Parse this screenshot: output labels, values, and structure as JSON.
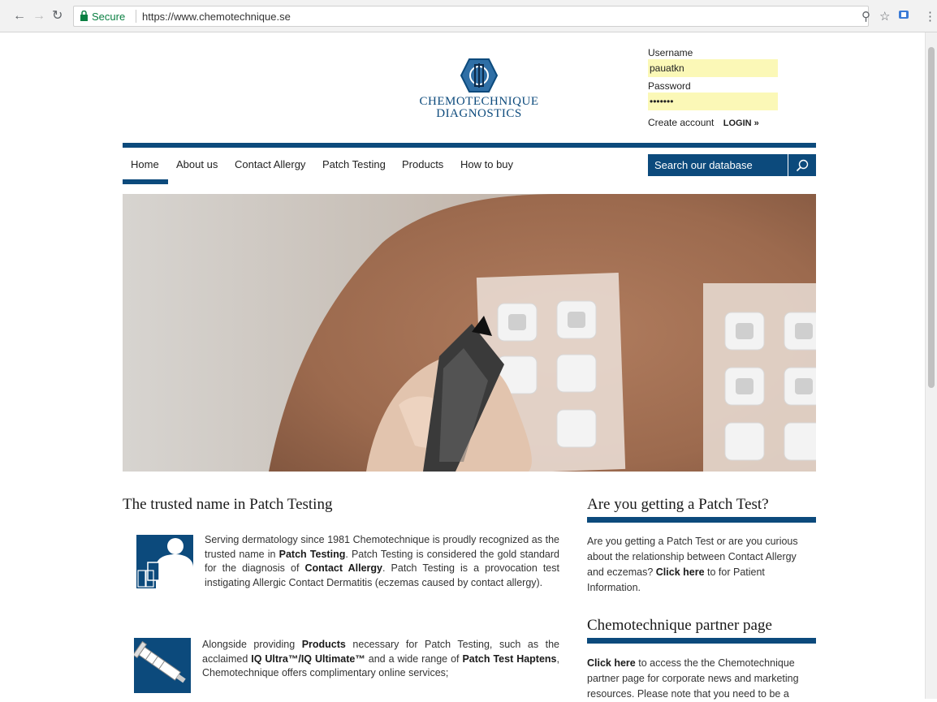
{
  "browser": {
    "secure_label": "Secure",
    "url": "https://www.chemotechnique.se"
  },
  "logo": {
    "line1": "CHEMOTECHNIQUE",
    "line2": "DIAGNOSTICS"
  },
  "login": {
    "username_label": "Username",
    "username_value": "pauatkn",
    "password_label": "Password",
    "password_value": "•••••••",
    "create_account": "Create account",
    "login_button": "LOGIN »"
  },
  "nav": {
    "items": [
      {
        "label": "Home"
      },
      {
        "label": "About us"
      },
      {
        "label": "Contact Allergy"
      },
      {
        "label": "Patch Testing"
      },
      {
        "label": "Products"
      },
      {
        "label": "How to buy"
      }
    ],
    "search_placeholder": "Search our database"
  },
  "main": {
    "title": "The trusted name in Patch Testing",
    "p1": {
      "t1": "Serving dermatology since 1981 Chemotechnique is proudly recognized as the trusted name in ",
      "b1": "Patch Testing",
      "t2": ". Patch Testing is considered the gold standard for the diagnosis of ",
      "b2": "Contact Allergy",
      "t3": ". Patch Testing is a provocation test instigating Allergic Contact Dermatitis (eczemas caused by contact allergy)."
    },
    "p2": {
      "t1": "Alongside providing ",
      "b1": "Products",
      "t2": " necessary for Patch Testing, such as the acclaimed ",
      "b2": "IQ Ultra™/IQ Ultimate™",
      "t3": " and a wide range of ",
      "b3": "Patch Test Haptens",
      "t4": ", Chemotechnique offers complimentary online services;"
    }
  },
  "sidebar": {
    "box1": {
      "title": "Are you getting a Patch Test?",
      "t1": "Are you getting a Patch Test or are you curious about the relationship between Contact Allergy and eczemas? ",
      "link": "Click here",
      "t2": " to for Patient Information."
    },
    "box2": {
      "title": "Chemotechnique partner page",
      "link": "Click here",
      "t1": " to access the the Chemotechnique partner page for corporate news and marketing resources. Please note that you need to be a"
    }
  }
}
